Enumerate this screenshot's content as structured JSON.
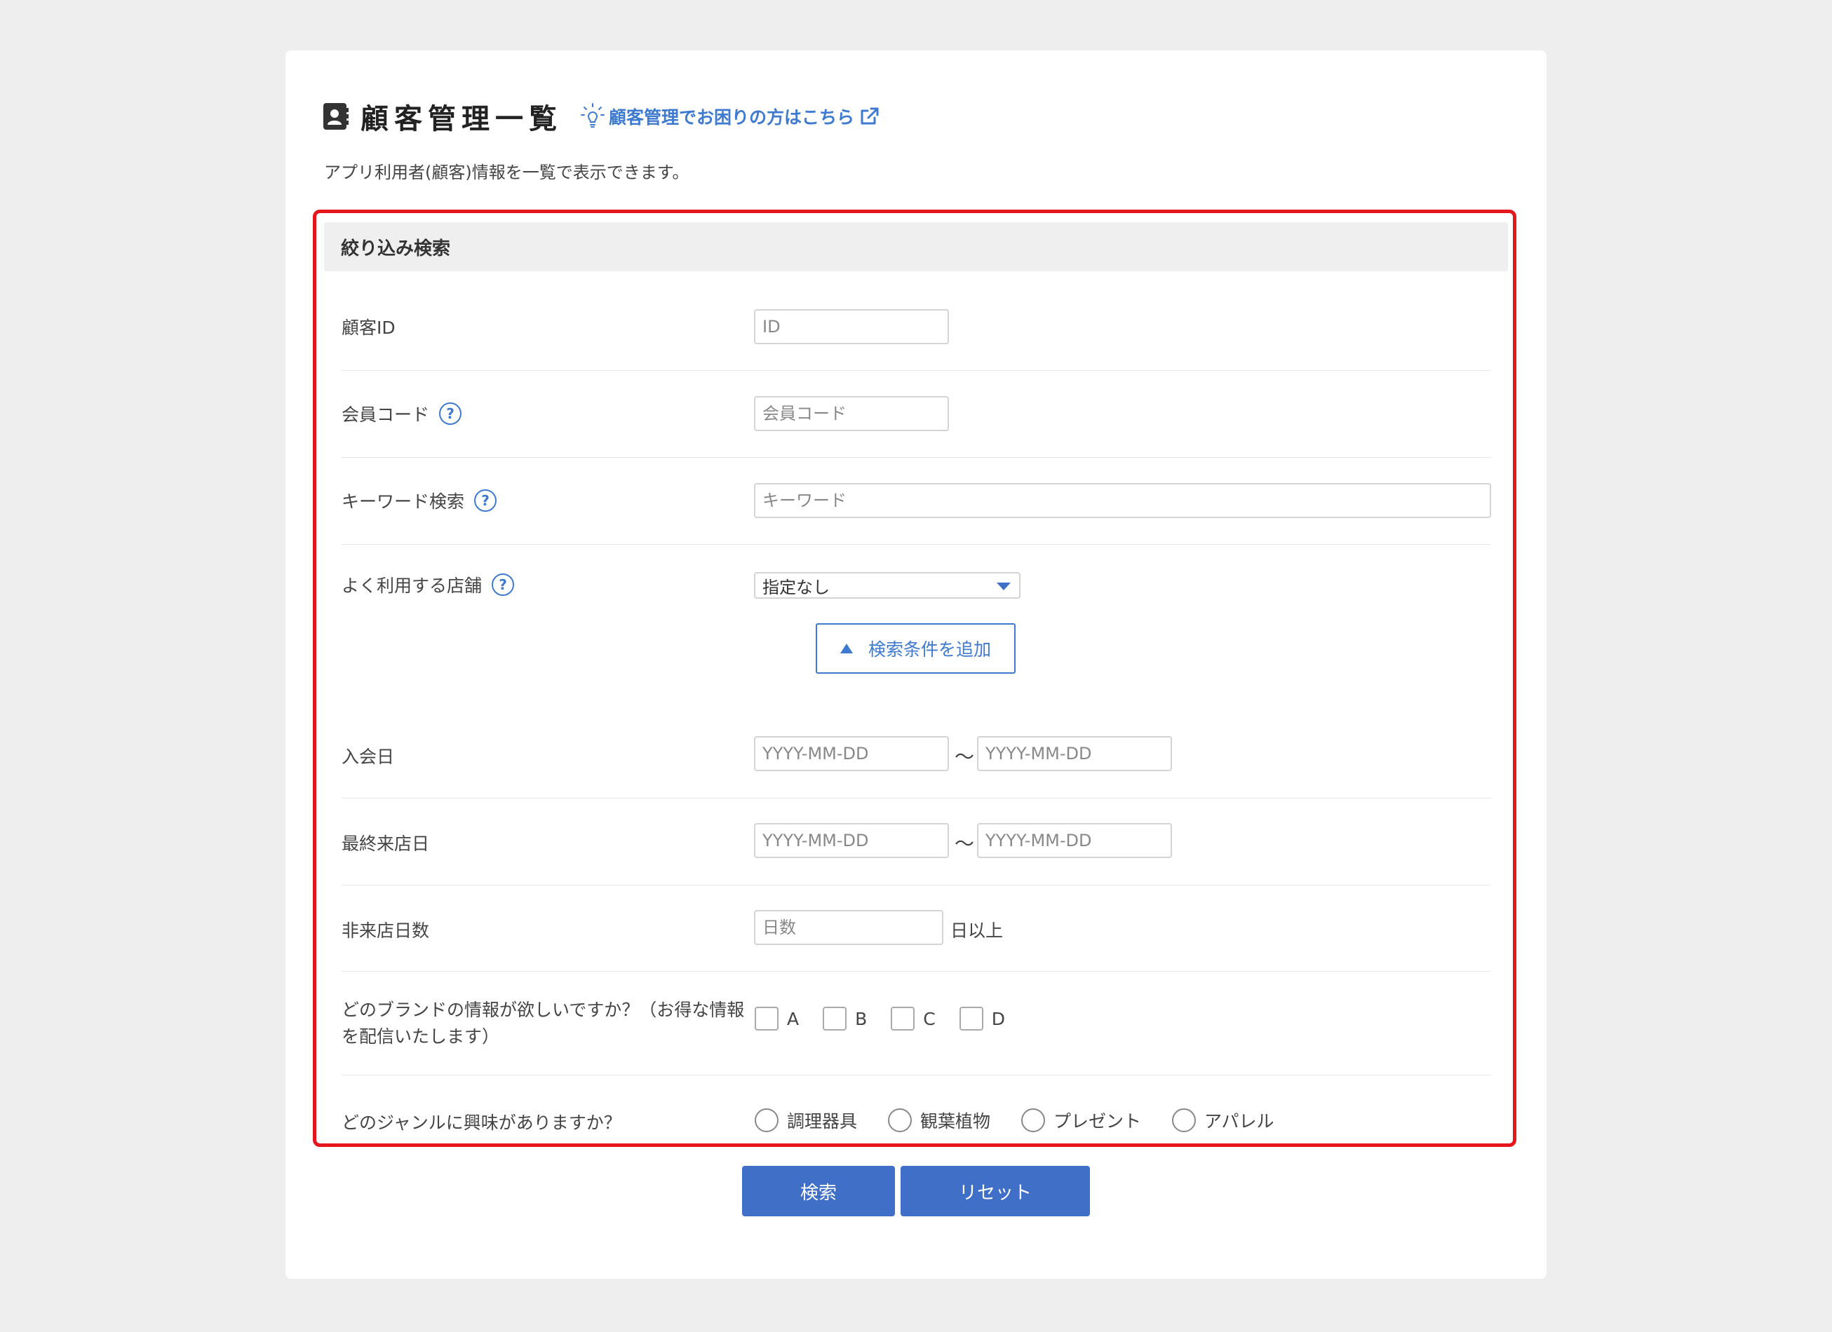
{
  "header": {
    "title": "顧客管理一覧",
    "help_link": "顧客管理でお困りの方はこちら",
    "description": "アプリ利用者(顧客)情報を一覧で表示できます。"
  },
  "filter": {
    "heading": "絞り込み検索",
    "customer_id": {
      "label": "顧客ID",
      "placeholder": "ID"
    },
    "member_code": {
      "label": "会員コード",
      "placeholder": "会員コード"
    },
    "keyword": {
      "label": "キーワード検索",
      "placeholder": "キーワード"
    },
    "store": {
      "label": "よく利用する店舗",
      "selected": "指定なし"
    },
    "add_condition_label": "検索条件を追加",
    "join_date": {
      "label": "入会日",
      "from_placeholder": "YYYY-MM-DD",
      "to_placeholder": "YYYY-MM-DD",
      "separator": "〜"
    },
    "last_visit": {
      "label": "最終来店日",
      "from_placeholder": "YYYY-MM-DD",
      "to_placeholder": "YYYY-MM-DD",
      "separator": "〜"
    },
    "no_visit_days": {
      "label": "非来店日数",
      "placeholder": "日数",
      "suffix": "日以上"
    },
    "brand": {
      "label_line1": "どのブランドの情報が欲しいですか？（お得な情報",
      "label_line2": "を配信いたします）",
      "options": [
        "A",
        "B",
        "C",
        "D"
      ]
    },
    "genre": {
      "label": "どのジャンルに興味がありますか？",
      "options": [
        "調理器具",
        "観葉植物",
        "プレゼント",
        "アパレル"
      ]
    }
  },
  "actions": {
    "search": "検索",
    "reset": "リセット"
  },
  "colors": {
    "accent": "#3f7ad1",
    "primary_button": "#3f6fc6",
    "highlight_frame": "#e5161c",
    "background": "#eeeeee"
  }
}
